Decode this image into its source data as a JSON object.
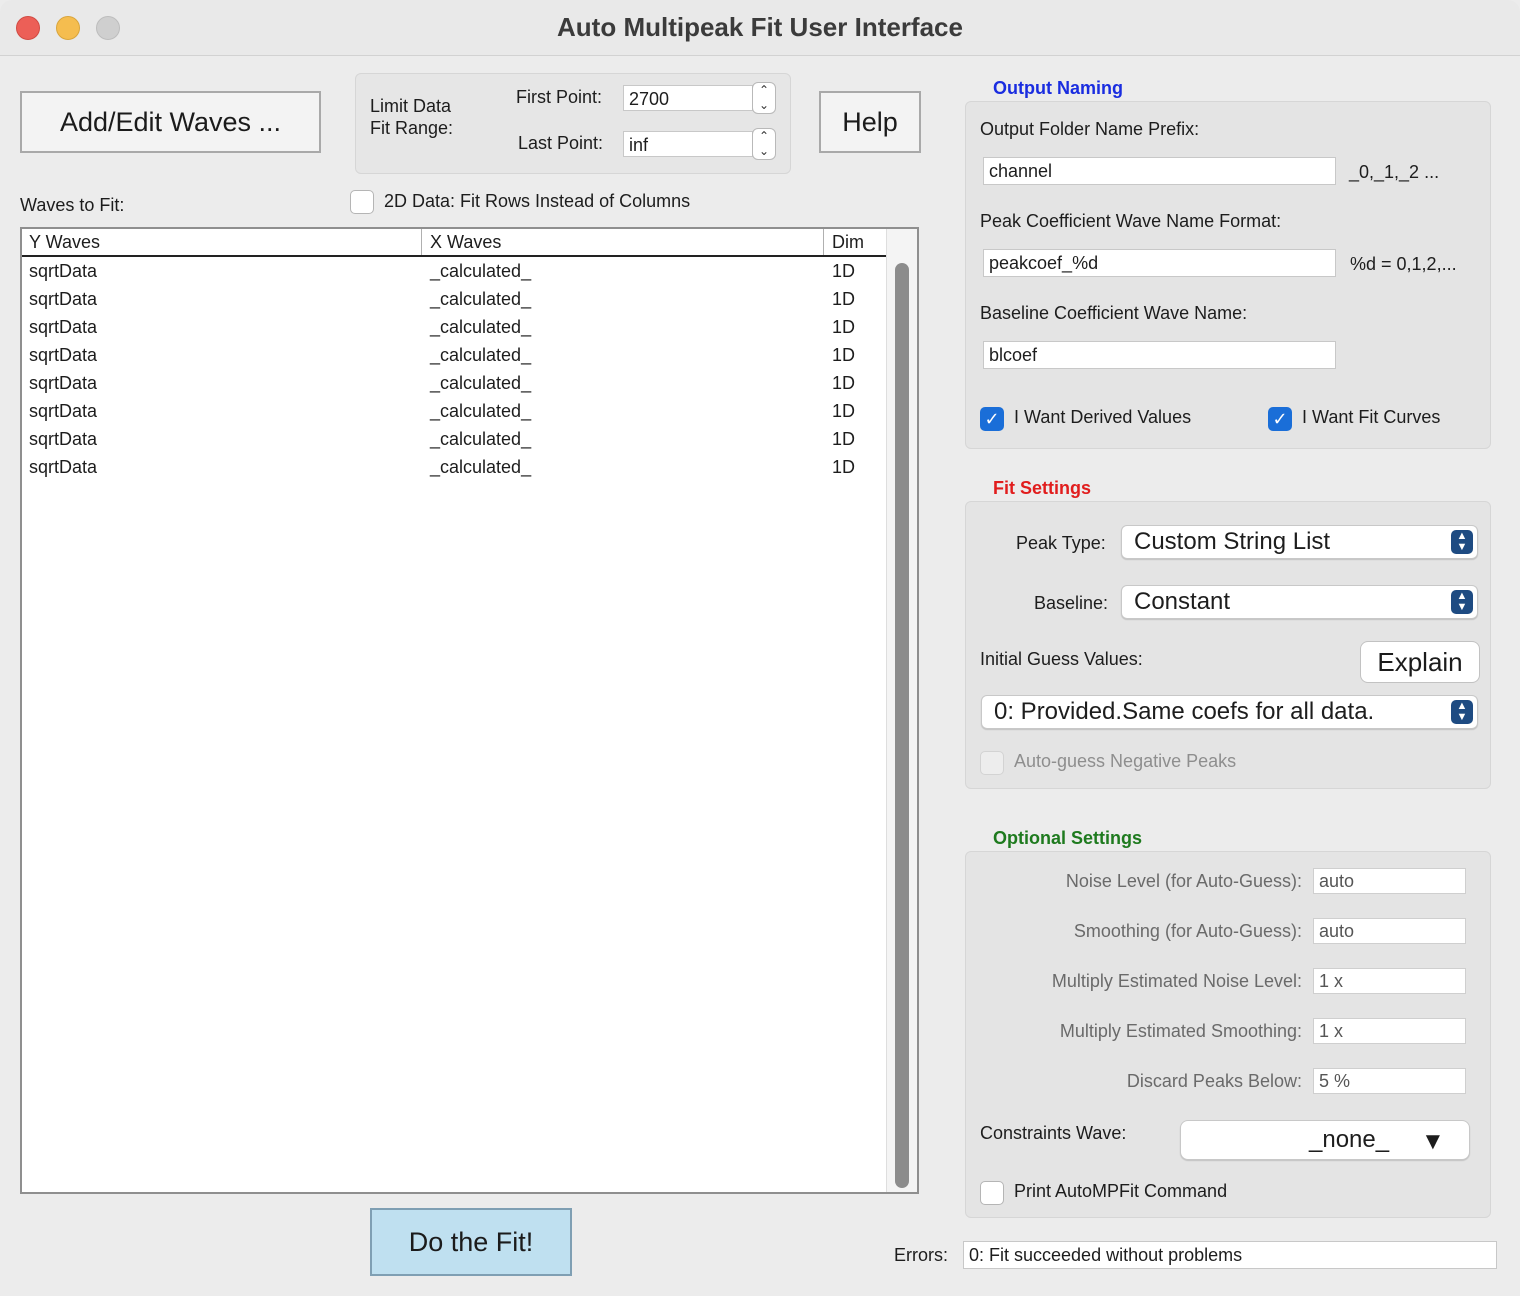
{
  "window": {
    "title": "Auto Multipeak Fit User Interface"
  },
  "top": {
    "add_edit_label": "Add/Edit Waves ...",
    "limit_label": "Limit Data\nFit Range:",
    "first_point_label": "First Point:",
    "first_point_value": "2700",
    "last_point_label": "Last Point:",
    "last_point_value": "inf",
    "help_label": "Help"
  },
  "waves": {
    "label": "Waves to Fit:",
    "fit_rows_label": "2D Data: Fit Rows Instead of Columns",
    "columns": [
      "Y Waves",
      "X Waves",
      "Dim"
    ],
    "rows": [
      [
        "sqrtData",
        "_calculated_",
        "1D"
      ],
      [
        "sqrtData",
        "_calculated_",
        "1D"
      ],
      [
        "sqrtData",
        "_calculated_",
        "1D"
      ],
      [
        "sqrtData",
        "_calculated_",
        "1D"
      ],
      [
        "sqrtData",
        "_calculated_",
        "1D"
      ],
      [
        "sqrtData",
        "_calculated_",
        "1D"
      ],
      [
        "sqrtData",
        "_calculated_",
        "1D"
      ],
      [
        "sqrtData",
        "_calculated_",
        "1D"
      ]
    ]
  },
  "do_fit_label": "Do the Fit!",
  "output_naming": {
    "title": "Output Naming",
    "folder_prefix_label": "Output Folder Name Prefix:",
    "folder_prefix_value": "channel",
    "folder_suffix_hint": "_0,_1,_2 ...",
    "peak_coef_label": "Peak Coefficient Wave Name Format:",
    "peak_coef_value": "peakcoef_%d",
    "peak_coef_hint": "%d = 0,1,2,...",
    "baseline_coef_label": "Baseline Coefficient Wave Name:",
    "baseline_coef_value": "blcoef",
    "derived_values_label": "I Want Derived Values",
    "derived_values_checked": true,
    "fit_curves_label": "I Want Fit Curves",
    "fit_curves_checked": true
  },
  "fit_settings": {
    "title": "Fit Settings",
    "peak_type_label": "Peak Type:",
    "peak_type_value": "Custom String List",
    "baseline_label": "Baseline:",
    "baseline_value": "Constant",
    "initial_guess_label": "Initial Guess Values:",
    "explain_label": "Explain",
    "initial_guess_value": "0: Provided.Same coefs for all data.",
    "negative_peaks_label": "Auto-guess Negative Peaks"
  },
  "optional_settings": {
    "title": "Optional Settings",
    "noise_label": "Noise Level (for Auto-Guess):",
    "noise_value": "auto",
    "smoothing_label": "Smoothing (for Auto-Guess):",
    "smoothing_value": "auto",
    "mult_noise_label": "Multiply Estimated Noise Level:",
    "mult_noise_value": "1 x",
    "mult_smooth_label": "Multiply Estimated Smoothing:",
    "mult_smooth_value": "1 x",
    "discard_label": "Discard Peaks Below:",
    "discard_value": "5 %",
    "constraints_label": "Constraints Wave:",
    "constraints_value": "_none_",
    "print_cmd_label": "Print AutoMPFit Command"
  },
  "errors": {
    "label": "Errors:",
    "value": "0: Fit succeeded without problems"
  },
  "colors": {
    "output_title": "#1a2de0",
    "fit_title": "#e11d1d",
    "optional_title": "#1e7a1e",
    "do_fit_bg": "#bfe0f0",
    "checkbox_blue": "#1a6ed8"
  }
}
